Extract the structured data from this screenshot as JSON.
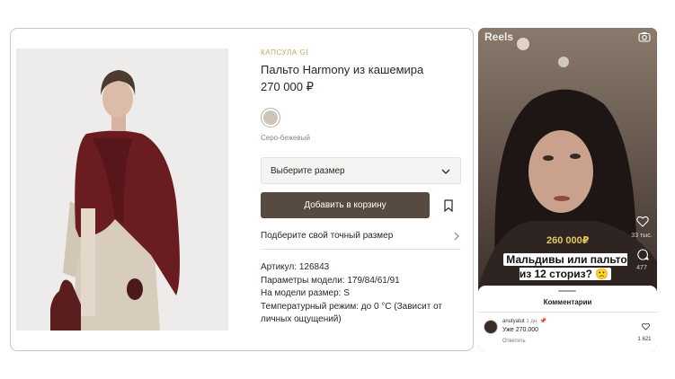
{
  "product": {
    "collection": "КАПСУЛА GI",
    "title": "Пальто Harmony из кашемира",
    "price": "270 000 ₽",
    "color_name": "Серо-беже­вый",
    "color_hex": "#cdc4ba",
    "size_select_placeholder": "Выберите размер",
    "add_to_cart_label": "Добавить в корзину",
    "fit_link_label": "Подберите свой точный размер",
    "specs": [
      "Артикул: 126843",
      "Параметры модели: 179/84/61/91",
      "На модели размер: S",
      "Температурный режим: до 0 °С (Зависит от личных ощущений)"
    ],
    "accent_button_color": "#574a40",
    "collection_color": "#c8a46a"
  },
  "reels": {
    "header_title": "Reels",
    "overlay_price": "260 000₽",
    "caption": "Мальдивы или пальто из 12 сториз? 🙁",
    "likes_count": "33 тыс.",
    "comments_count": "477",
    "sheet_title": "Комментарии",
    "comment": {
      "username": "anutyatut",
      "time": "1 дн.",
      "text": "Уже 270.000",
      "reply_label": "Ответить",
      "likes": "1 621"
    }
  }
}
